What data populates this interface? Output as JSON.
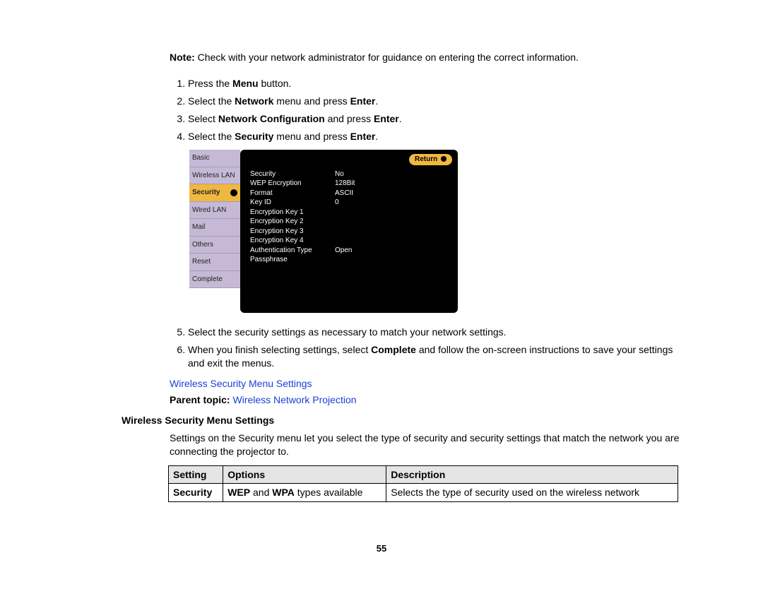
{
  "note": {
    "label": "Note:",
    "text": " Check with your network administrator for guidance on entering the correct information."
  },
  "steps_a": [
    {
      "pre": "Press the ",
      "bold": "Menu",
      "post": " button."
    },
    {
      "pre": "Select the ",
      "bold": "Network",
      "post": " menu and press ",
      "bold2": "Enter",
      "post2": "."
    },
    {
      "pre": "Select ",
      "bold": "Network Configuration",
      "post": " and press ",
      "bold2": "Enter",
      "post2": "."
    },
    {
      "pre": "Select the ",
      "bold": "Security",
      "post": " menu and press ",
      "bold2": "Enter",
      "post2": "."
    }
  ],
  "menu": {
    "sidebar": [
      "Basic",
      "Wireless LAN",
      "Security",
      "Wired LAN",
      "Mail",
      "Others",
      "Reset",
      "Complete"
    ],
    "selected_index": 2,
    "return_label": "Return",
    "rows": [
      {
        "label": "Security",
        "value": "No"
      },
      {
        "label": "WEP Encryption",
        "value": "128Bit"
      },
      {
        "label": "Format",
        "value": "ASCII"
      },
      {
        "label": "Key ID",
        "value": "0"
      },
      {
        "label": "Encryption Key 1",
        "value": ""
      },
      {
        "label": "Encryption Key 2",
        "value": ""
      },
      {
        "label": "Encryption Key 3",
        "value": ""
      },
      {
        "label": "Encryption Key 4",
        "value": ""
      },
      {
        "label": "Authentication Type",
        "value": "Open"
      },
      {
        "label": "Passphrase",
        "value": ""
      }
    ]
  },
  "steps_b": [
    {
      "text": "Select the security settings as necessary to match your network settings."
    },
    {
      "pre": "When you finish selecting settings, select ",
      "bold": "Complete",
      "post": " and follow the on-screen instructions to save your settings and exit the menus."
    }
  ],
  "links": {
    "child": "Wireless Security Menu Settings",
    "parent_label": "Parent topic:",
    "parent_link": "Wireless Network Projection"
  },
  "section": {
    "heading": "Wireless Security Menu Settings",
    "para": "Settings on the Security menu let you select the type of security and security settings that match the network you are connecting the projector to."
  },
  "table": {
    "headers": [
      "Setting",
      "Options",
      "Description"
    ],
    "row": {
      "setting": "Security",
      "options_bold1": "WEP",
      "options_mid": " and ",
      "options_bold2": "WPA",
      "options_post": " types available",
      "description": "Selects the type of security used on the wireless network"
    }
  },
  "page_number": "55"
}
